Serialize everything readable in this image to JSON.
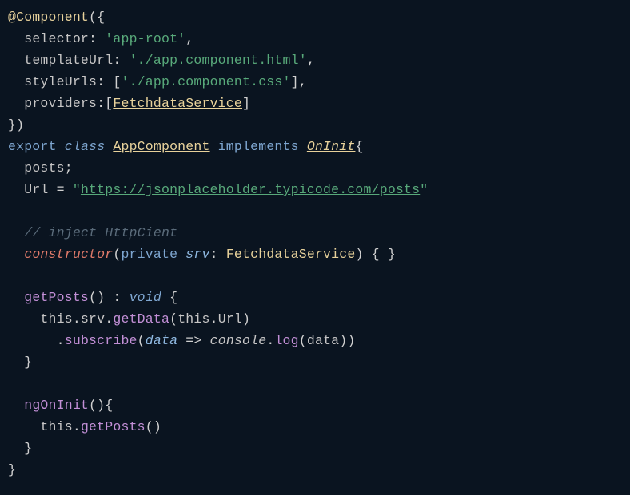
{
  "code": {
    "l1": {
      "decorator": "@Component",
      "open": "({"
    },
    "l2": {
      "prop": "selector",
      "col": ":",
      "sp": " ",
      "val": "'app-root'",
      "comma": ","
    },
    "l3": {
      "prop": "templateUrl",
      "col": ":",
      "sp": " ",
      "val": "'./app.component.html'",
      "comma": ","
    },
    "l4": {
      "prop": "styleUrls",
      "col": ":",
      "sp": " ",
      "b1": "[",
      "val": "'./app.component.css'",
      "b2": "]",
      "comma": ","
    },
    "l5": {
      "prop": "providers",
      "col": ":",
      "b1": "[",
      "type": "FetchdataService",
      "b2": "]"
    },
    "l6": {
      "close": "})"
    },
    "l7": {
      "kw_export": "export",
      "kw_class": "class",
      "classname": "AppComponent",
      "kw_impl": "implements",
      "interface": "OnInit",
      "brace": "{"
    },
    "l8": {
      "ident": "posts",
      "semi": ";"
    },
    "l9": {
      "ident": "Url",
      "eq": " = ",
      "q1": "\"",
      "url": "https://jsonplaceholder.typicode.com/posts",
      "q2": "\""
    },
    "l10": {
      "comment": "// inject HttpCient"
    },
    "l11": {
      "ctor": "constructor",
      "p1": "(",
      "mod": "private",
      "param": "srv",
      "col": ":",
      "type": "FetchdataService",
      "p2": ")",
      "body": " { }"
    },
    "l12": {
      "method": "getPosts",
      "parens": "()",
      "col": " : ",
      "void": "void",
      "brace": " {"
    },
    "l13": {
      "this": "this",
      "d1": ".",
      "srv": "srv",
      "d2": ".",
      "method": "getData",
      "p1": "(",
      "this2": "this",
      "d3": ".",
      "url": "Url",
      "p2": ")"
    },
    "l14": {
      "dot": ".",
      "method": "subscribe",
      "p1": "(",
      "param": "data",
      "arrow": " => ",
      "console": "console",
      "d2": ".",
      "log": "log",
      "p2": "(",
      "arg": "data",
      "p3": "))"
    },
    "l15": {
      "brace": "}"
    },
    "l16": {
      "method": "ngOnInit",
      "parens": "()",
      "brace": "{"
    },
    "l17": {
      "this": "this",
      "d1": ".",
      "method": "getPosts",
      "parens": "()"
    },
    "l18": {
      "brace": "}"
    },
    "l19": {
      "brace": "}"
    }
  }
}
